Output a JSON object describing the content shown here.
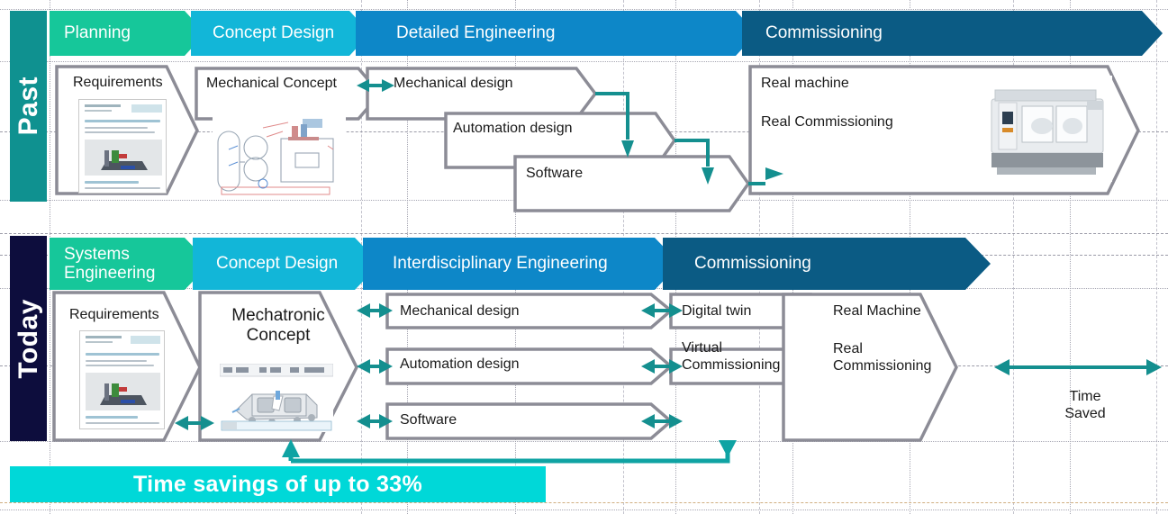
{
  "meta": {
    "title": "Past vs Today engineering process comparison",
    "colors": {
      "green": "#16c79a",
      "cyan": "#12b6d8",
      "blue": "#0d87c8",
      "darkblue": "#0b5b84",
      "teal": "#0f9190",
      "navy": "#0d0d3d",
      "accent_bar": "#00d8d8",
      "outline_gray": "#8c8c96",
      "arrow_teal": "#148f8f"
    }
  },
  "rows": {
    "past": {
      "side_label": "Past",
      "side_color": "#0f9190",
      "phases": [
        {
          "label": "Planning",
          "color": "#16c79a"
        },
        {
          "label": "Concept Design",
          "color": "#12b6d8"
        },
        {
          "label": "Detailed Engineering",
          "color": "#0d87c8"
        },
        {
          "label": "Commissioning",
          "color": "#0b5b84"
        }
      ],
      "boxes": [
        {
          "name": "requirements",
          "label": "Requirements"
        },
        {
          "name": "mechanical-concept",
          "label": "Mechanical Concept"
        },
        {
          "name": "mechanical-design",
          "label": "Mechanical design"
        },
        {
          "name": "automation-design",
          "label": "Automation design"
        },
        {
          "name": "software",
          "label": "Software"
        },
        {
          "name": "commissioning",
          "label": ""
        }
      ],
      "commissioning_lines": [
        "Real machine",
        "Real Commissioning"
      ]
    },
    "today": {
      "side_label": "Today",
      "side_color": "#0d0d3d",
      "phases": [
        {
          "label": "Systems\nEngineering",
          "color": "#16c79a"
        },
        {
          "label": "Concept Design",
          "color": "#12b6d8"
        },
        {
          "label": "Interdisciplinary Engineering",
          "color": "#0d87c8"
        },
        {
          "label": "Commissioning",
          "color": "#0b5b84"
        }
      ],
      "boxes": [
        {
          "name": "requirements",
          "label": "Requirements"
        },
        {
          "name": "mechatronic-concept",
          "label": "Mechatronic\nConcept"
        },
        {
          "name": "mechanical-design",
          "label": "Mechanical design"
        },
        {
          "name": "automation-design",
          "label": "Automation design"
        },
        {
          "name": "software",
          "label": "Software"
        },
        {
          "name": "digital-twin",
          "label": "Digital twin"
        },
        {
          "name": "virtual-commissioning",
          "label": "Virtual\nCommissioning"
        }
      ],
      "commissioning_lines": [
        "Real Machine",
        "Real\nCommissioning"
      ],
      "time_saved_label": "Time\nSaved"
    }
  },
  "footer": {
    "savings_label": "Time savings of up to 33%",
    "bar_color": "#00d8d8"
  }
}
